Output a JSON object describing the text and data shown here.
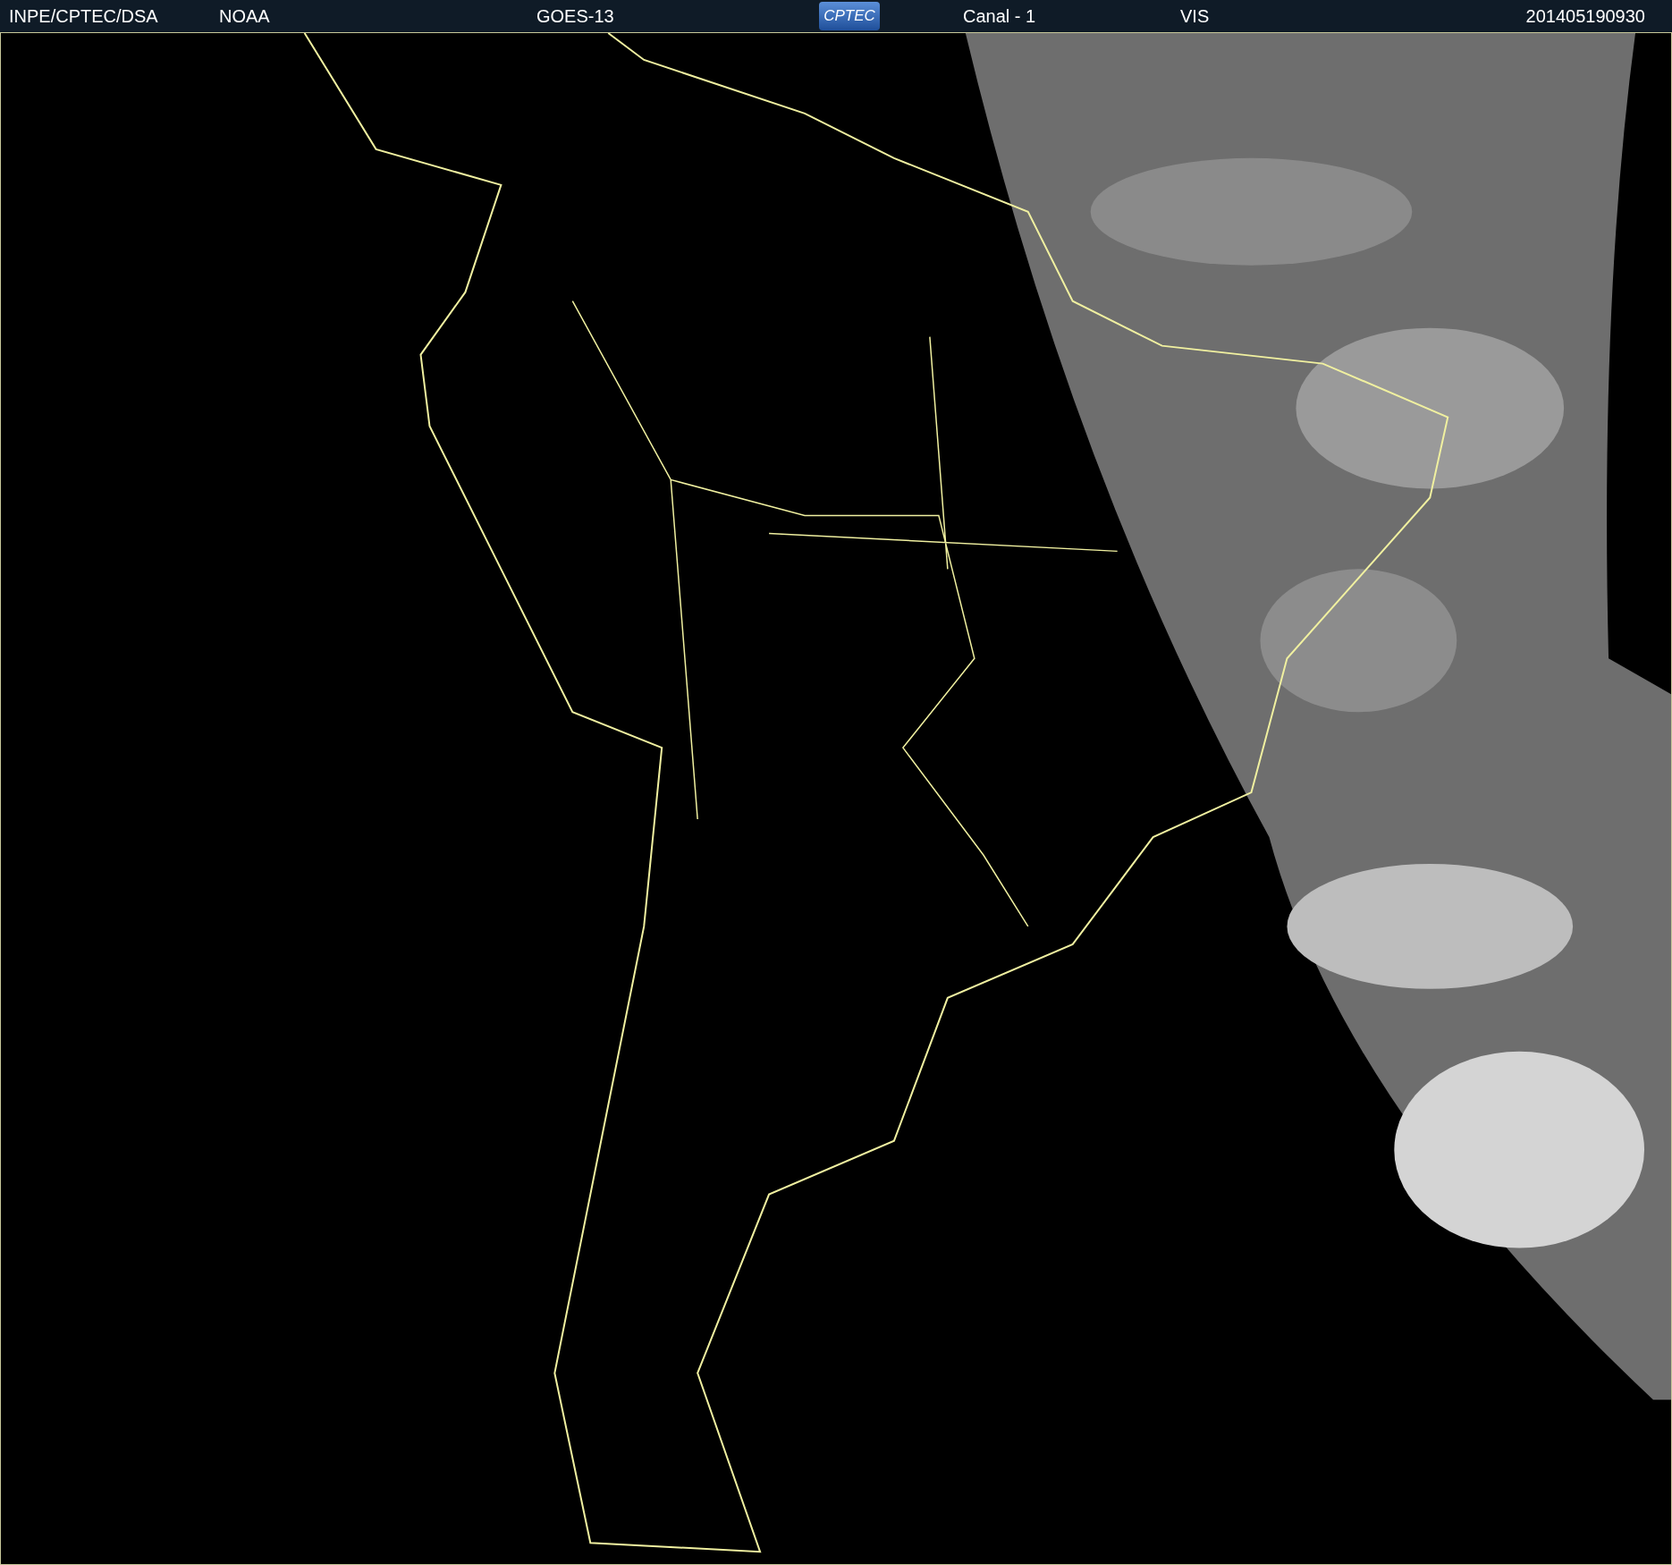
{
  "header": {
    "source": "INPE/CPTEC/DSA",
    "agency": "NOAA",
    "satellite": "GOES-13",
    "logo": "CPTEC",
    "channel": "Canal - 1",
    "band": "VIS",
    "timestamp": "201405190930"
  }
}
